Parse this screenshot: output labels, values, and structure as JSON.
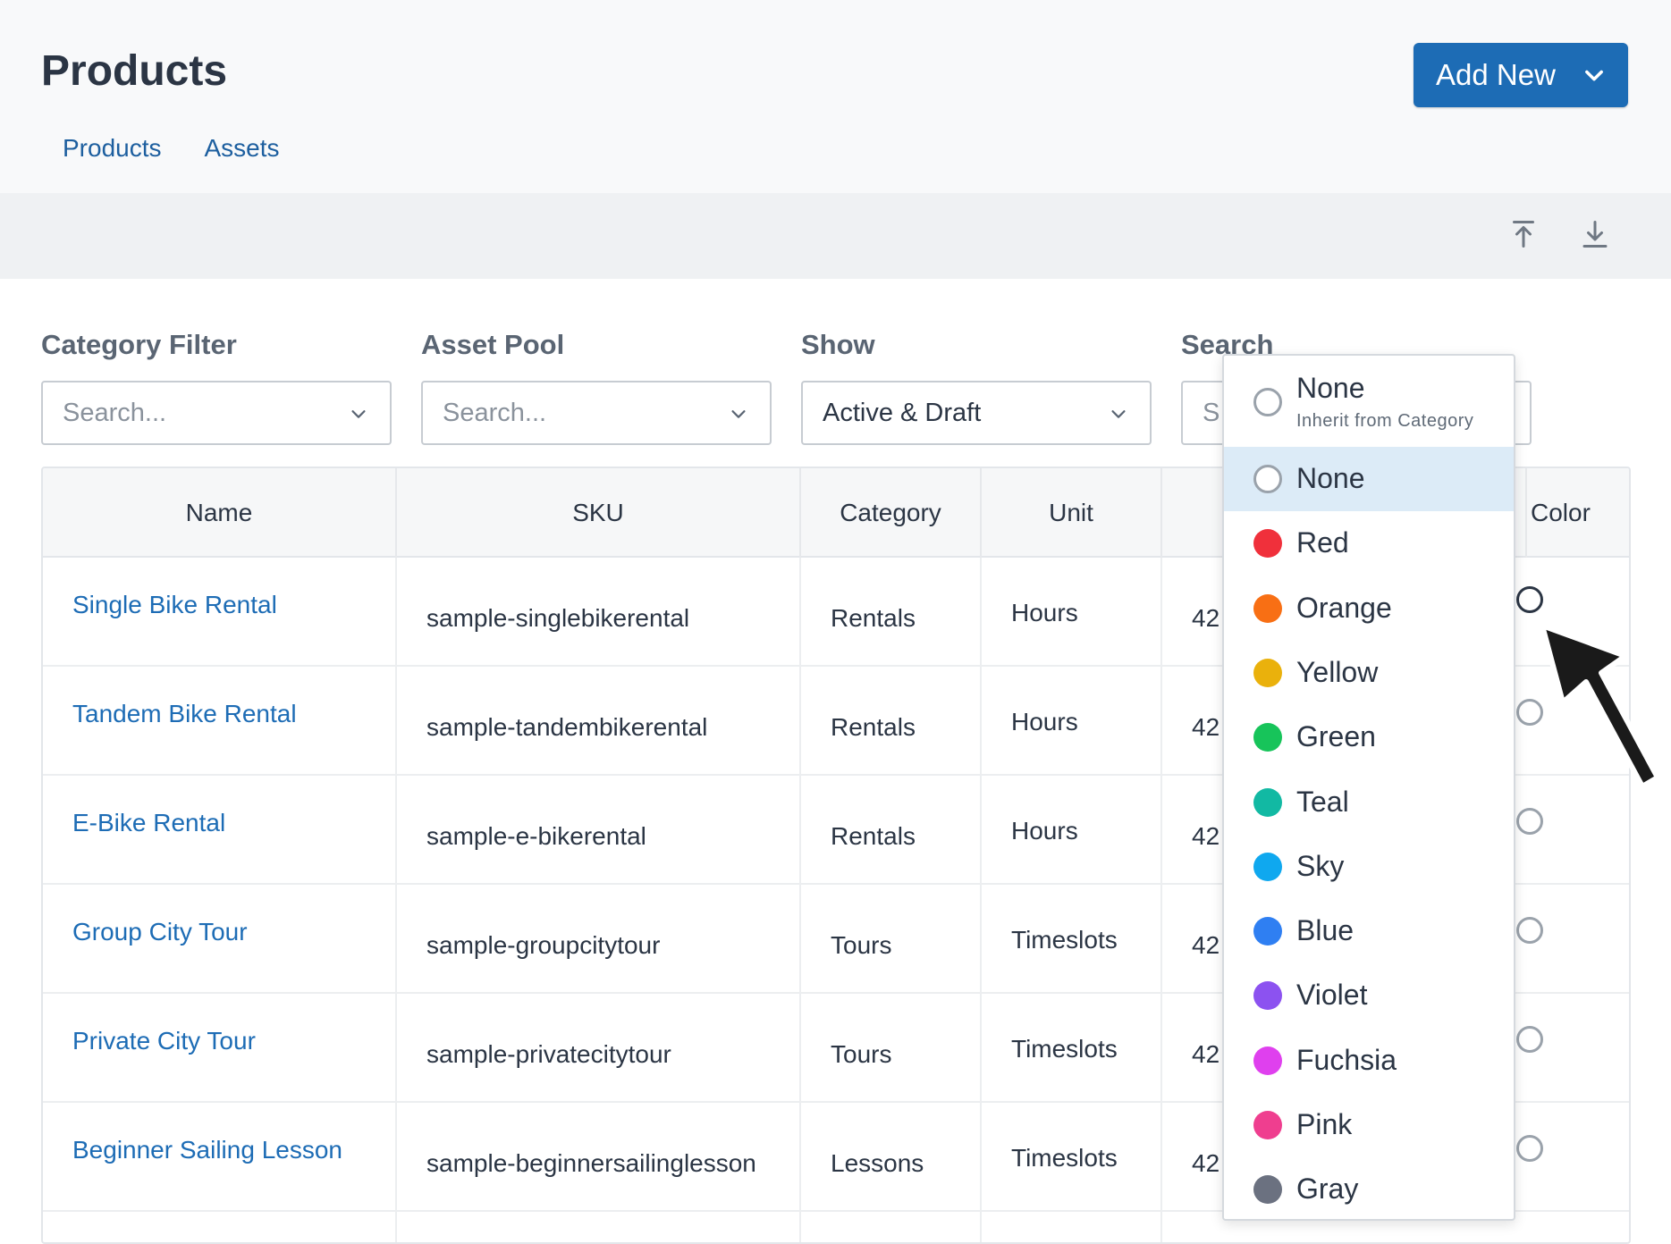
{
  "header": {
    "title": "Products",
    "add_new_label": "Add New",
    "tabs": [
      {
        "label": "Products"
      },
      {
        "label": "Assets"
      }
    ]
  },
  "toolbar": {
    "icons": [
      "upload-icon",
      "download-icon"
    ]
  },
  "filters": {
    "category": {
      "label": "Category Filter",
      "placeholder": "Search..."
    },
    "asset_pool": {
      "label": "Asset Pool",
      "placeholder": "Search..."
    },
    "show": {
      "label": "Show",
      "value": "Active & Draft"
    },
    "search": {
      "label": "Search",
      "partial_text": "S"
    }
  },
  "table": {
    "columns": [
      "Name",
      "SKU",
      "Category",
      "Unit",
      "Color"
    ],
    "rows": [
      {
        "name": "Single Bike Rental",
        "sku": "sample-singlebikerental",
        "category": "Rentals",
        "unit": "Hours",
        "partial": "42"
      },
      {
        "name": "Tandem Bike Rental",
        "sku": "sample-tandembikerental",
        "category": "Rentals",
        "unit": "Hours",
        "partial": "42"
      },
      {
        "name": "E-Bike Rental",
        "sku": "sample-e-bikerental",
        "category": "Rentals",
        "unit": "Hours",
        "partial": "42"
      },
      {
        "name": "Group City Tour",
        "sku": "sample-groupcitytour",
        "category": "Tours",
        "unit": "Timeslots",
        "partial": "42"
      },
      {
        "name": "Private City Tour",
        "sku": "sample-privatecitytour",
        "category": "Tours",
        "unit": "Timeslots",
        "partial": "42"
      },
      {
        "name": "Beginner Sailing Lesson",
        "sku": "sample-beginnersailinglesson",
        "category": "Lessons",
        "unit": "Timeslots",
        "partial": "42"
      }
    ]
  },
  "color_dropdown": {
    "inherit": {
      "label": "None",
      "sublabel": "Inherit from Category"
    },
    "options": [
      {
        "label": "None",
        "color": null,
        "highlighted": true
      },
      {
        "label": "Red",
        "color": "#f0303b"
      },
      {
        "label": "Orange",
        "color": "#f86f14"
      },
      {
        "label": "Yellow",
        "color": "#eab10c"
      },
      {
        "label": "Green",
        "color": "#17c45a"
      },
      {
        "label": "Teal",
        "color": "#12b9a3"
      },
      {
        "label": "Sky",
        "color": "#0fa8ef"
      },
      {
        "label": "Blue",
        "color": "#2f7ff2"
      },
      {
        "label": "Violet",
        "color": "#8c52f0"
      },
      {
        "label": "Fuchsia",
        "color": "#df40ee"
      },
      {
        "label": "Pink",
        "color": "#ef3e8f"
      },
      {
        "label": "Gray",
        "color": "#6b7180"
      }
    ]
  },
  "colors": {
    "accent": "#1d6cb5",
    "link": "#1d6cb5",
    "highlight": "#dcebf7"
  }
}
